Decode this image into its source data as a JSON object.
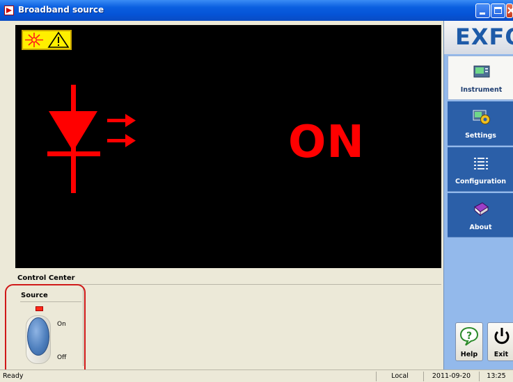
{
  "window": {
    "title": "Broadband source",
    "controls": [
      "minimize-icon",
      "maximize-icon",
      "close-icon"
    ]
  },
  "display": {
    "state_text": "ON",
    "warning_icons": [
      "laser-radiation-icon",
      "caution-triangle-icon"
    ],
    "emitter_icon": "led-diode-icon",
    "accent_color": "#ff0000"
  },
  "control_center": {
    "title": "Control Center",
    "source": {
      "title": "Source",
      "indicator_color": "#ff2a1a",
      "on_label": "On",
      "off_label": "Off",
      "state": "on"
    }
  },
  "sidebar": {
    "logo": "EXFO",
    "items": [
      {
        "label": "Instrument",
        "icon": "instrument-icon",
        "active": true
      },
      {
        "label": "Settings",
        "icon": "settings-gear-icon",
        "active": false
      },
      {
        "label": "Configuration",
        "icon": "configuration-list-icon",
        "active": false
      },
      {
        "label": "About",
        "icon": "about-book-icon",
        "active": false
      }
    ],
    "help_label": "Help",
    "exit_label": "Exit"
  },
  "status_bar": {
    "status": "Ready",
    "mode": "Local",
    "date": "2011-09-20",
    "time": "13:25"
  }
}
